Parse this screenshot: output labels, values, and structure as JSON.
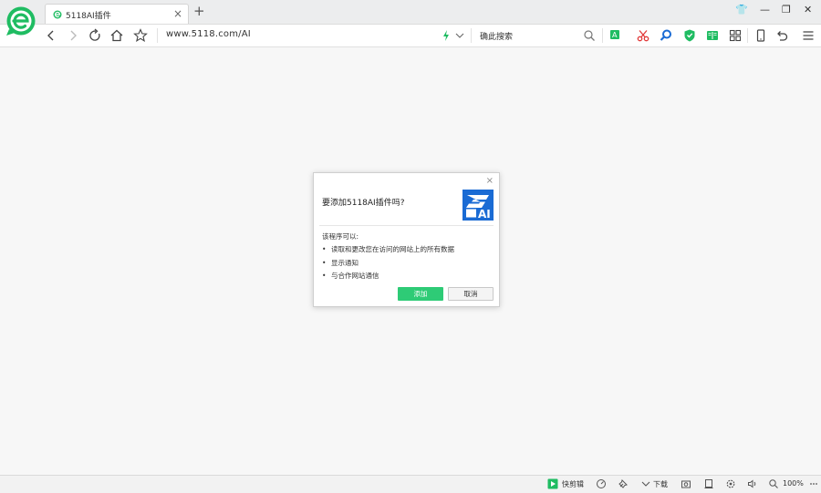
{
  "tab": {
    "title": "5118AI插件",
    "close": "×"
  },
  "newtab": "+",
  "window": {
    "skin": "👕",
    "minimize": "—",
    "maximize": "❐",
    "close": "✕"
  },
  "address": {
    "url": "www.5118.com/AI"
  },
  "search": {
    "text": "确此搜索"
  },
  "dialog": {
    "close": "×",
    "heading": "要添加5118AI插件吗?",
    "subheading": "该程序可以:",
    "permissions": [
      "读取和更改您在访问的网站上的所有数据",
      "显示通知",
      "与合作网站通信"
    ],
    "bullet": "•",
    "add_label": "添加",
    "cancel_label": "取消"
  },
  "status": {
    "screenshot_label": "快剪辑",
    "download_label": "下载",
    "zoom": "100%"
  },
  "colors": {
    "brand_green": "#2ecb76",
    "ai_blue": "#1a6bd4"
  }
}
